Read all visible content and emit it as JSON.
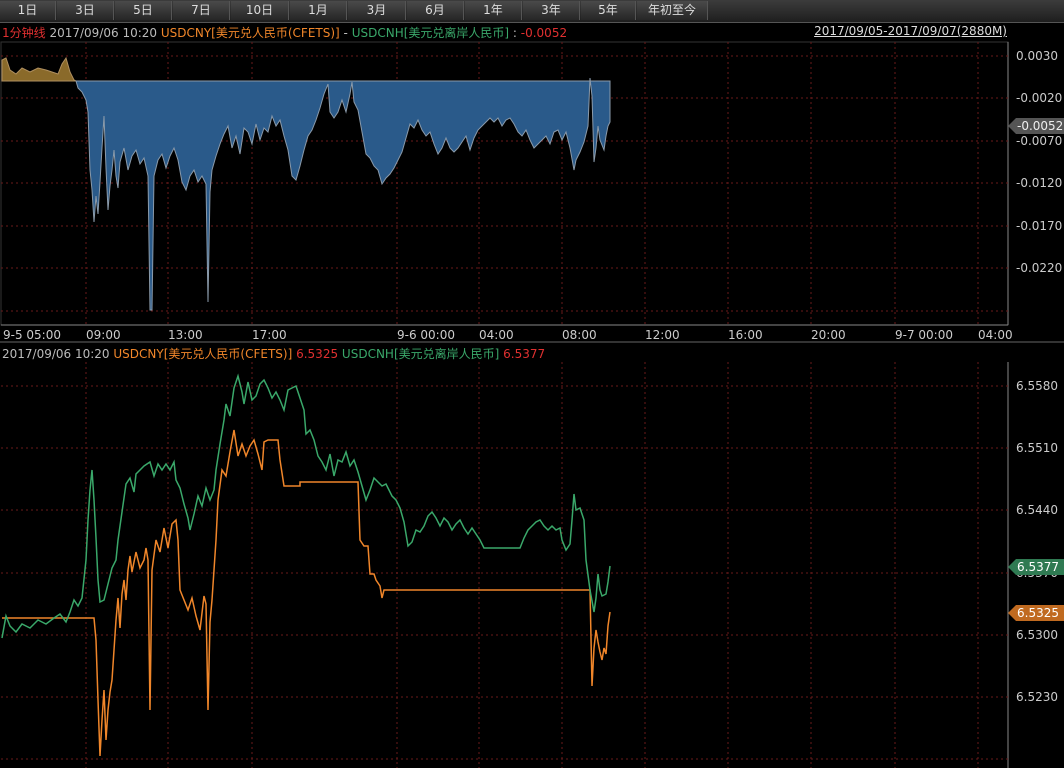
{
  "range_buttons": [
    "1日",
    "3日",
    "5日",
    "7日",
    "10日",
    "1月",
    "3月",
    "6月",
    "1年",
    "3年",
    "5年",
    "年初至今"
  ],
  "top_header": {
    "interval": "1分钟线",
    "datetime": "2017/09/06 10:20",
    "series_a": "USDCNY[美元兑人民币(CFETS)]",
    "minus": " - ",
    "series_b": "USDCNH[美元兑离岸人民币]",
    "colon": " : ",
    "value": "-0.0052",
    "range_label": "2017/09/05-2017/09/07(2880M)"
  },
  "bottom_header": {
    "datetime": "2017/09/06 10:20",
    "series_a": "USDCNY[美元兑人民币(CFETS)]",
    "series_a_value": "6.5325",
    "series_b": "USDCNH[美元兑离岸人民币]",
    "series_b_value": "6.5377"
  },
  "colors": {
    "usdcny": "#f0862a",
    "usdcnh": "#3aa86a",
    "spread_fill": "#2a5a8a",
    "spread_line": "#8a9aaa",
    "spread_pos": "#8a6a2a",
    "grid": "#6a1a1a",
    "neg_text": "#e03030"
  },
  "chart_data": [
    {
      "type": "area",
      "title": "USDCNY - USDCNH spread (1分钟线)",
      "x_ticks": [
        "9-5 05:00",
        "09:00",
        "13:00",
        "17:00",
        "9-6 00:00",
        "04:00",
        "08:00",
        "12:00",
        "16:00",
        "20:00",
        "9-7 00:00",
        "04:00"
      ],
      "y_ticks": [
        "0.0030",
        "-0.0020",
        "-0.0070",
        "-0.0120",
        "-0.0170",
        "-0.0220"
      ],
      "ylim": [
        -0.025,
        0.006
      ],
      "last_value_tag": "-0.0052",
      "grid": true
    },
    {
      "type": "line",
      "series": [
        {
          "name": "USDCNY[美元兑人民币(CFETS)]",
          "last": 6.5325
        },
        {
          "name": "USDCNH[美元兑离岸人民币]",
          "last": 6.5377
        }
      ],
      "y_ticks": [
        "6.5580",
        "6.5510",
        "6.5440",
        "6.5370",
        "6.5300",
        "6.5230"
      ],
      "last_value_tags": {
        "usdcny": "6.5325",
        "usdcnh": "6.5377"
      },
      "grid": true
    }
  ]
}
